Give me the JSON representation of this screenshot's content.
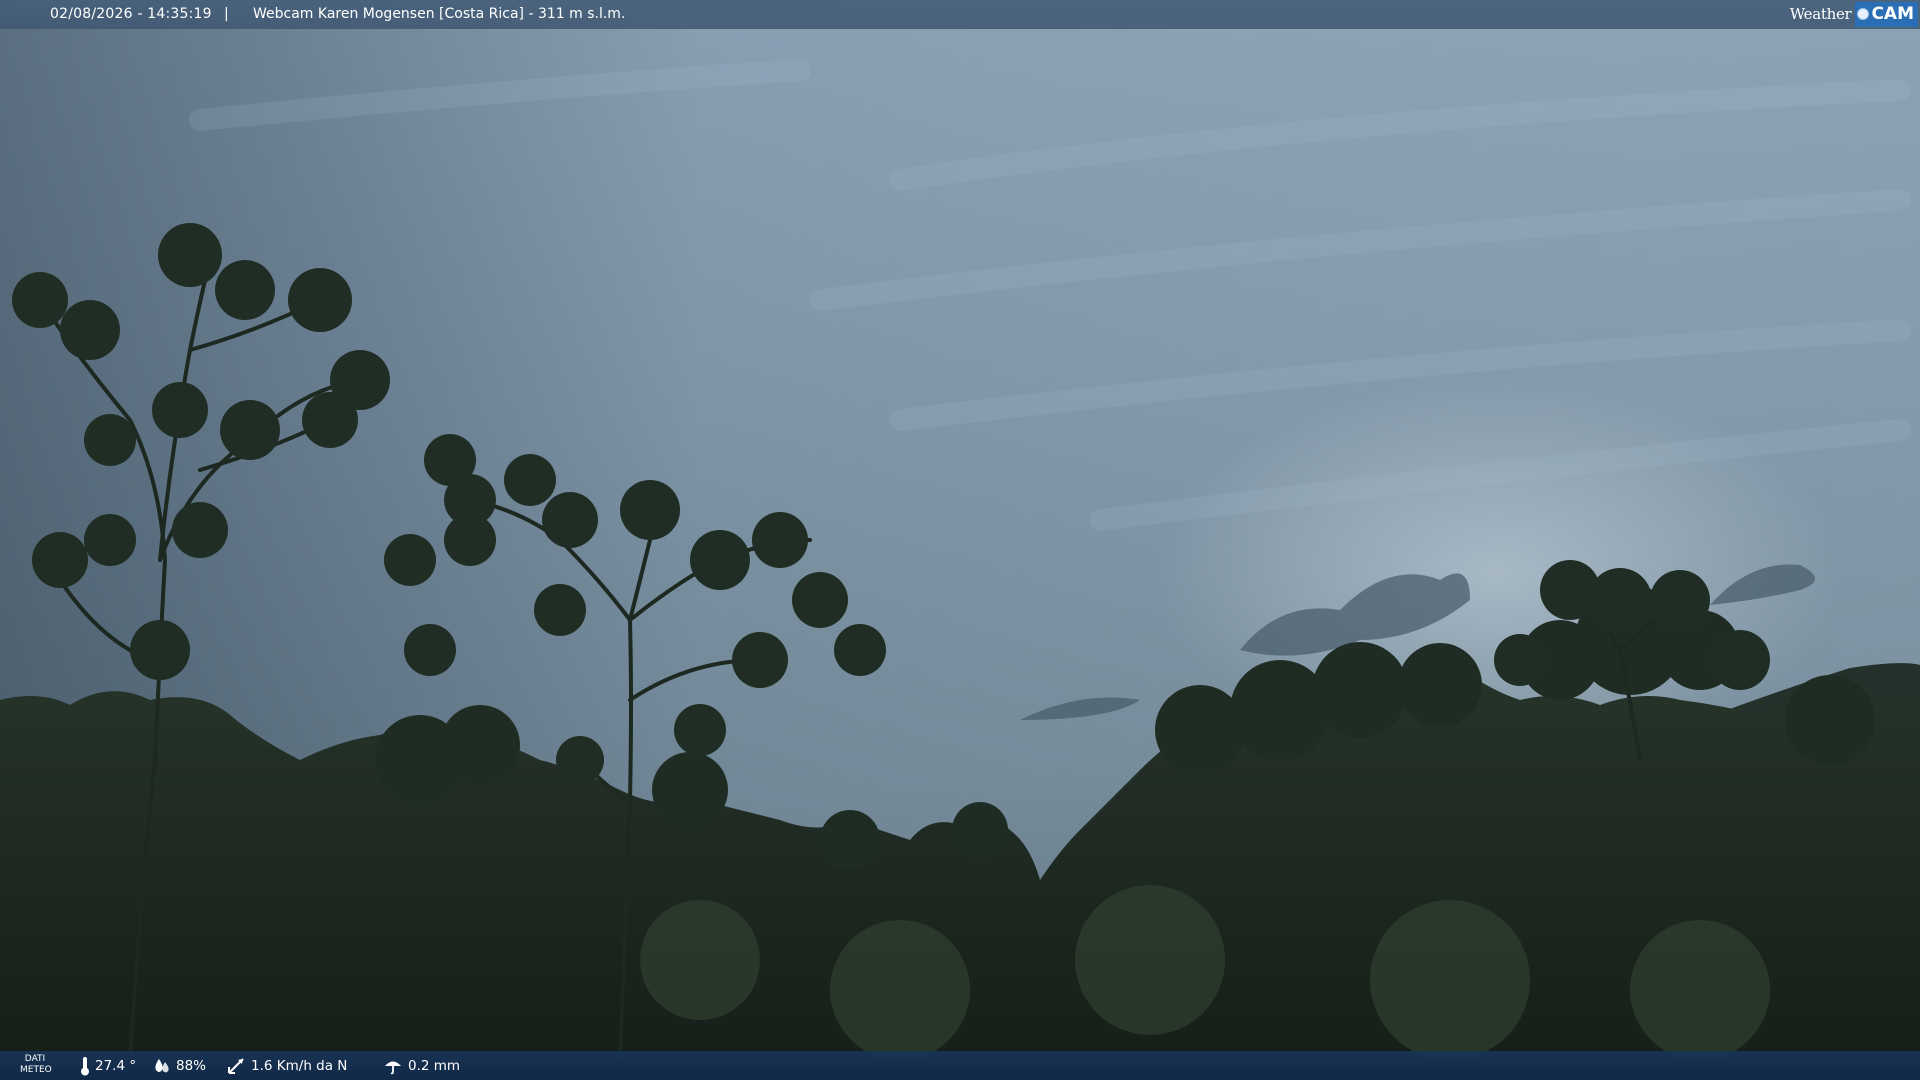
{
  "overlay": {
    "datetime": "02/08/2026 - 14:35:19",
    "separator": "|",
    "caption": "Webcam Karen Mogensen [Costa Rica]  - 311 m s.l.m.",
    "logo_weather": "Weather",
    "logo_cam": "CAM"
  },
  "weather": {
    "label_line1": "DATI",
    "label_line2": "METEO",
    "temperature": "27.4 °",
    "humidity": "88%",
    "wind": "1.6 Km/h da N",
    "rain": "0.2 mm"
  },
  "colors": {
    "sky_top": "#7d97ad",
    "sky_bottom": "#5f7889",
    "foliage": "#1e2b22",
    "bar_top": "#465f7a",
    "bar_bottom": "#183458",
    "logo_accent": "#2a6fb5"
  }
}
